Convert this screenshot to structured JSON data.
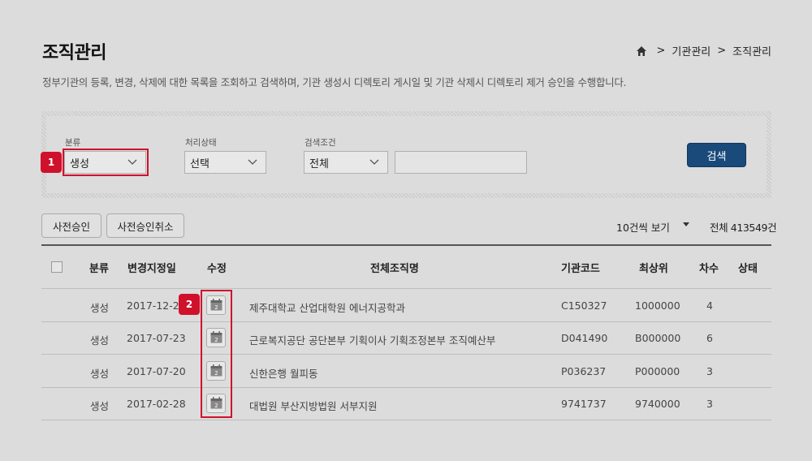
{
  "page": {
    "title": "조직관리",
    "description": "정부기관의 등록, 변경, 삭제에 대한 목록을 조회하고 검색하며, 기관 생성시 디렉토리 게시일 및 기관 삭제시 디렉토리 제거 승인을 수행합니다."
  },
  "breadcrumb": {
    "sep": ">",
    "items": [
      "기관관리",
      "조직관리"
    ]
  },
  "search": {
    "category_label": "분류",
    "category_value": "생성",
    "status_label": "처리상태",
    "status_value": "선택",
    "condition_label": "검색조건",
    "condition_value": "전체",
    "keyword_value": "",
    "button": "검색"
  },
  "markers": [
    "1",
    "2"
  ],
  "actions": {
    "pre_approve": "사전승인",
    "pre_approve_cancel": "사전승인취소"
  },
  "list": {
    "per_page": "10건씩 보기",
    "total": "전체 413549건"
  },
  "table": {
    "headers": {
      "category": "분류",
      "change_date": "변경지정일",
      "edit": "수정",
      "org_name": "전체조직명",
      "org_code": "기관코드",
      "top_code": "최상위",
      "degree": "차수",
      "status": "상태"
    },
    "rows": [
      {
        "category": "생성",
        "date": "2017-12-2",
        "name": "제주대학교 산업대학원 에너지공학과",
        "code": "C150327",
        "top": "1000000",
        "degree": "4",
        "status": ""
      },
      {
        "category": "생성",
        "date": "2017-07-23",
        "name": "근로복지공단 공단본부 기획이사 기획조정본부 조직예산부",
        "code": "D041490",
        "top": "B000000",
        "degree": "6",
        "status": ""
      },
      {
        "category": "생성",
        "date": "2017-07-20",
        "name": "신한은행 월피동",
        "code": "P036237",
        "top": "P000000",
        "degree": "3",
        "status": ""
      },
      {
        "category": "생성",
        "date": "2017-02-28",
        "name": "대법원 부산지방법원 서부지원",
        "code": "9741737",
        "top": "9740000",
        "degree": "3",
        "status": ""
      }
    ]
  },
  "colors": {
    "accent_red": "#d0112b",
    "button_blue": "#1a4a7a",
    "background": "#dcdcdc"
  }
}
